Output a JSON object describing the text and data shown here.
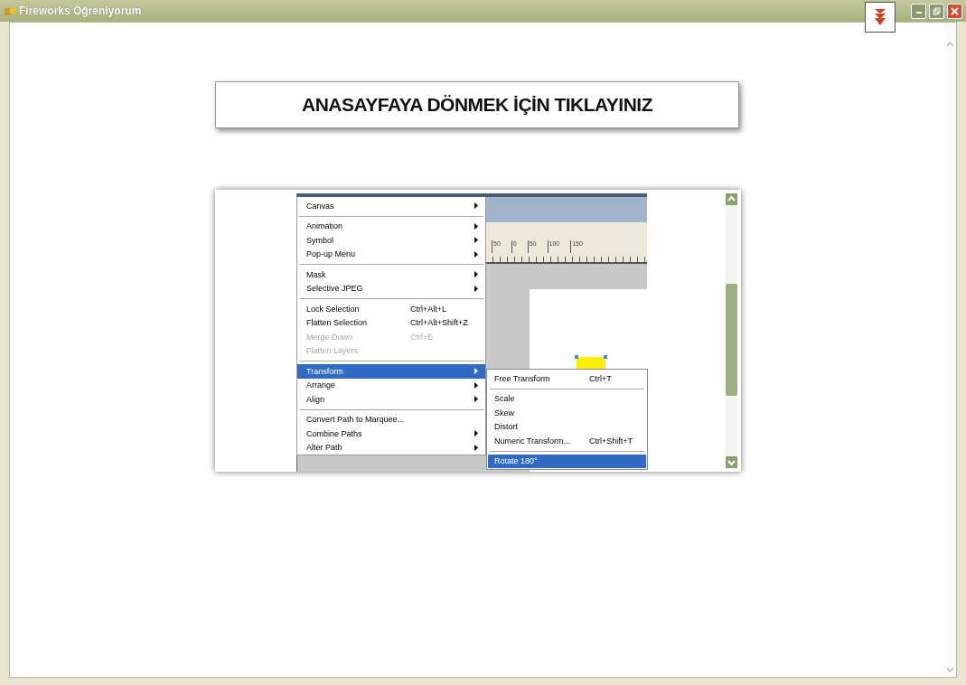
{
  "window": {
    "title": "Fireworks Öğreniyorum"
  },
  "banner": {
    "text": "ANASAYFAYA DÖNMEK İÇİN TIKLAYINIZ"
  },
  "screenshot": {
    "ruler": [
      "50",
      "0",
      "50",
      "100",
      "150"
    ],
    "menu": {
      "groups": [
        [
          {
            "label": "Canvas",
            "submenu": true,
            "disabled": false,
            "selected": false
          }
        ],
        [
          {
            "label": "Animation",
            "submenu": true,
            "disabled": false,
            "selected": false
          },
          {
            "label": "Symbol",
            "submenu": true,
            "disabled": false,
            "selected": false
          },
          {
            "label": "Pop-up Menu",
            "submenu": true,
            "disabled": false,
            "selected": false
          }
        ],
        [
          {
            "label": "Mask",
            "submenu": true,
            "disabled": false,
            "selected": false
          },
          {
            "label": "Selective JPEG",
            "submenu": true,
            "disabled": false,
            "selected": false
          }
        ],
        [
          {
            "label": "Lock Selection",
            "shortcut": "Ctrl+Alt+L",
            "submenu": false,
            "disabled": false,
            "selected": false
          },
          {
            "label": "Flatten Selection",
            "shortcut": "Ctrl+Alt+Shift+Z",
            "submenu": false,
            "disabled": false,
            "selected": false
          },
          {
            "label": "Merge Down",
            "shortcut": "Ctrl+E",
            "submenu": false,
            "disabled": true,
            "selected": false
          },
          {
            "label": "Flatten Layers",
            "submenu": false,
            "disabled": true,
            "selected": false
          }
        ],
        [
          {
            "label": "Transform",
            "submenu": true,
            "disabled": false,
            "selected": true
          },
          {
            "label": "Arrange",
            "submenu": true,
            "disabled": false,
            "selected": false
          },
          {
            "label": "Align",
            "submenu": true,
            "disabled": false,
            "selected": false
          }
        ],
        [
          {
            "label": "Convert Path to Marquee...",
            "submenu": false,
            "disabled": false,
            "selected": false
          },
          {
            "label": "Combine Paths",
            "submenu": true,
            "disabled": false,
            "selected": false
          },
          {
            "label": "Alter Path",
            "submenu": true,
            "disabled": false,
            "selected": false
          }
        ]
      ]
    },
    "submenu": {
      "groups": [
        [
          {
            "label": "Free Transform",
            "shortcut": "Ctrl+T",
            "selected": false
          }
        ],
        [
          {
            "label": "Scale",
            "selected": false
          },
          {
            "label": "Skew",
            "selected": false
          },
          {
            "label": "Distort",
            "selected": false
          },
          {
            "label": "Numeric Transform...",
            "shortcut": "Ctrl+Shift+T",
            "selected": false
          }
        ],
        [
          {
            "label": "Rotate 180°",
            "selected": true
          }
        ]
      ]
    }
  }
}
